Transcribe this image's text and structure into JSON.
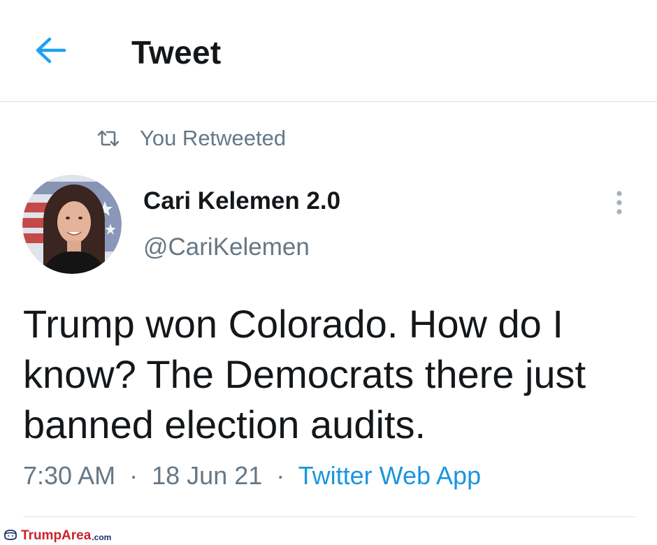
{
  "header": {
    "title": "Tweet",
    "back_icon": "arrow-left-icon",
    "accent_color": "#1da1f2"
  },
  "retweet": {
    "icon": "retweet-icon",
    "label": "You Retweeted"
  },
  "author": {
    "display_name": "Cari Kelemen 2.0",
    "handle": "@CariKelemen",
    "avatar_icon": "profile-photo"
  },
  "more_icon": "more-vertical-icon",
  "tweet": {
    "text": "Trump won Colorado. How do I know? The Democrats there just banned election audits.",
    "time": "7:30 AM",
    "date": "18 Jun 21",
    "source": "Twitter Web App",
    "separator": "·"
  },
  "watermark": {
    "brand": "TrumpArea",
    "suffix": ".com",
    "color": "#c9232c"
  }
}
